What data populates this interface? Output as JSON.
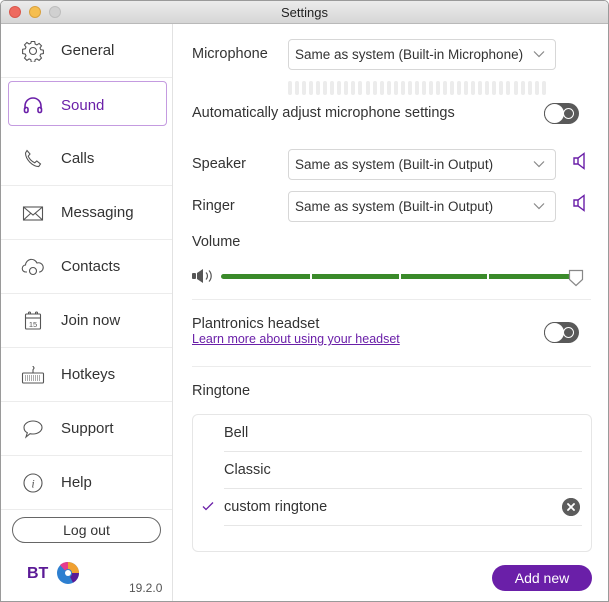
{
  "window": {
    "title": "Settings",
    "controls": [
      "close",
      "minimize",
      "maximize"
    ]
  },
  "sidebar": {
    "items": [
      {
        "label": "General",
        "icon": "gear-icon"
      },
      {
        "label": "Sound",
        "icon": "headphones-icon",
        "active": true
      },
      {
        "label": "Calls",
        "icon": "phone-icon"
      },
      {
        "label": "Messaging",
        "icon": "envelope-icon"
      },
      {
        "label": "Contacts",
        "icon": "cloud-contacts-icon"
      },
      {
        "label": "Join now",
        "icon": "calendar-icon",
        "icon_text": "15"
      },
      {
        "label": "Hotkeys",
        "icon": "keyboard-icon"
      },
      {
        "label": "Support",
        "icon": "speech-bubble-icon"
      },
      {
        "label": "Help",
        "icon": "info-icon",
        "icon_text": "i"
      }
    ],
    "logout_label": "Log out",
    "logo_text": "BT",
    "version": "19.2.0"
  },
  "sound": {
    "microphone": {
      "label": "Microphone",
      "value": "Same as system (Built-in Microphone)",
      "level_bars": 37,
      "level_fraction": 0
    },
    "auto_adjust": {
      "label": "Automatically adjust microphone settings",
      "enabled": false
    },
    "speaker": {
      "label": "Speaker",
      "value": "Same as system (Built-in Output)"
    },
    "ringer": {
      "label": "Ringer",
      "value": "Same as system (Built-in Output)"
    },
    "volume": {
      "label": "Volume",
      "value_percent": 100,
      "segments": 4
    },
    "headset": {
      "label": "Plantronics headset",
      "link": "Learn more about using your headset",
      "enabled": false
    },
    "ringtone": {
      "label": "Ringtone",
      "items": [
        {
          "label": "Bell",
          "selected": false,
          "removable": false
        },
        {
          "label": "Classic",
          "selected": false,
          "removable": false
        },
        {
          "label": "custom ringtone",
          "selected": true,
          "removable": true
        }
      ],
      "add_label": "Add new"
    }
  },
  "colors": {
    "accent": "#6a1fa8",
    "volume_fill": "#3a8a2a",
    "toggle_off": "#595959"
  }
}
